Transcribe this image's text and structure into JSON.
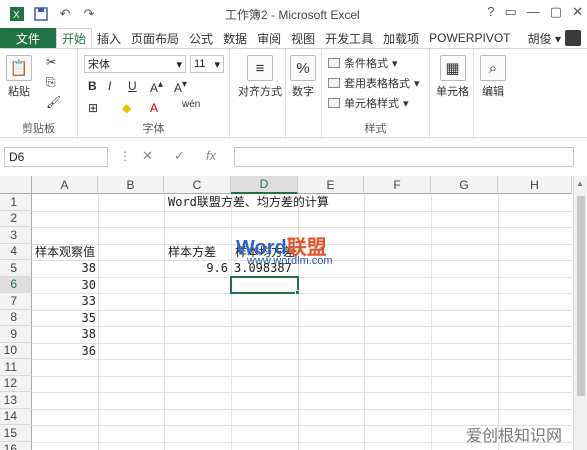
{
  "window": {
    "title": "工作簿2 - Microsoft Excel",
    "controls": [
      "?",
      "▭",
      "—",
      "▢",
      "✕"
    ]
  },
  "qat": {
    "icons": [
      "excel-icon",
      "save-icon",
      "undo-icon",
      "redo-icon"
    ]
  },
  "tabs": {
    "file": "文件",
    "items": [
      "开始",
      "插入",
      "页面布局",
      "公式",
      "数据",
      "审阅",
      "视图",
      "开发工具",
      "加载项",
      "POWERPIVOT"
    ],
    "active": "开始",
    "user": "胡俊 ▾"
  },
  "ribbon": {
    "clipboard": {
      "paste": "粘贴",
      "label": "剪贴板"
    },
    "font": {
      "name": "宋体",
      "size": "11",
      "bold": "B",
      "italic": "I",
      "underline": "U",
      "wen": "wén",
      "label": "字体"
    },
    "alignment": {
      "label": "对齐方式"
    },
    "number": {
      "label": "数字",
      "symbol": "%"
    },
    "styles": {
      "conditional": "条件格式",
      "table": "套用表格格式",
      "cell": "单元格样式",
      "label": "样式"
    },
    "cells": {
      "label": "单元格"
    },
    "editing": {
      "label": "编辑"
    }
  },
  "formula_bar": {
    "name_box": "D6",
    "cancel": "✕",
    "enter": "✓",
    "fx": "fx",
    "value": ""
  },
  "sheet": {
    "columns": [
      "A",
      "B",
      "C",
      "D",
      "E",
      "F",
      "G",
      "H"
    ],
    "rows": [
      "1",
      "2",
      "3",
      "4",
      "5",
      "6",
      "7",
      "8",
      "9",
      "10",
      "11",
      "12",
      "13",
      "14",
      "15",
      "16"
    ],
    "selected_column": "D",
    "selected_row": "6",
    "cells": {
      "C1": "Word联盟方差、均方差的计算",
      "A4": "样本观察值",
      "C4": "样本方差",
      "D4": "样本均方差",
      "A5": "38",
      "A6": "30",
      "A7": "33",
      "A8": "35",
      "A9": "38",
      "A10": "36",
      "C5": "9.6",
      "D5": "3.098387"
    }
  },
  "watermarks": {
    "logo_a": "Word",
    "logo_b": "联盟",
    "url": "www.wordlm.com",
    "bottom": "爱创根知识网"
  },
  "colors": {
    "accent": "#217346",
    "watermark_blue": "#2a63c9"
  }
}
